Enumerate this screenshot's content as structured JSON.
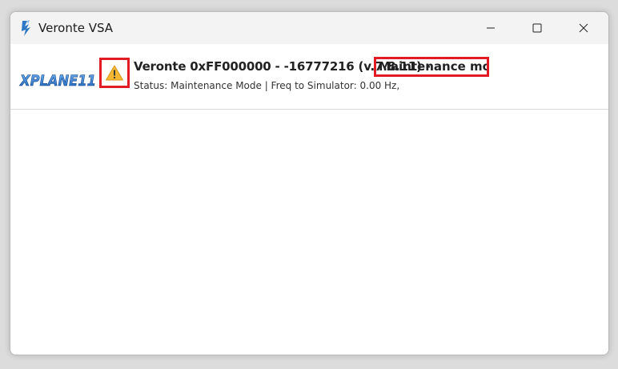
{
  "window": {
    "title": "Veronte VSA",
    "icon": "veronte-app-icon"
  },
  "header": {
    "logo_text": "XPLANE11",
    "warning_icon": "warning-triangle-icon",
    "device_title": "Veronte 0xFF000000 - -16777216 (v.7.8.11) -",
    "mode_label": "Maintenance mode",
    "status_text": "Status: Maintenance Mode | Freq to Simulator: 0.00 Hz,"
  },
  "colors": {
    "highlight_border": "#e21c25",
    "warning_fill": "#f5b731",
    "logo_blue": "#1c6fc8"
  }
}
